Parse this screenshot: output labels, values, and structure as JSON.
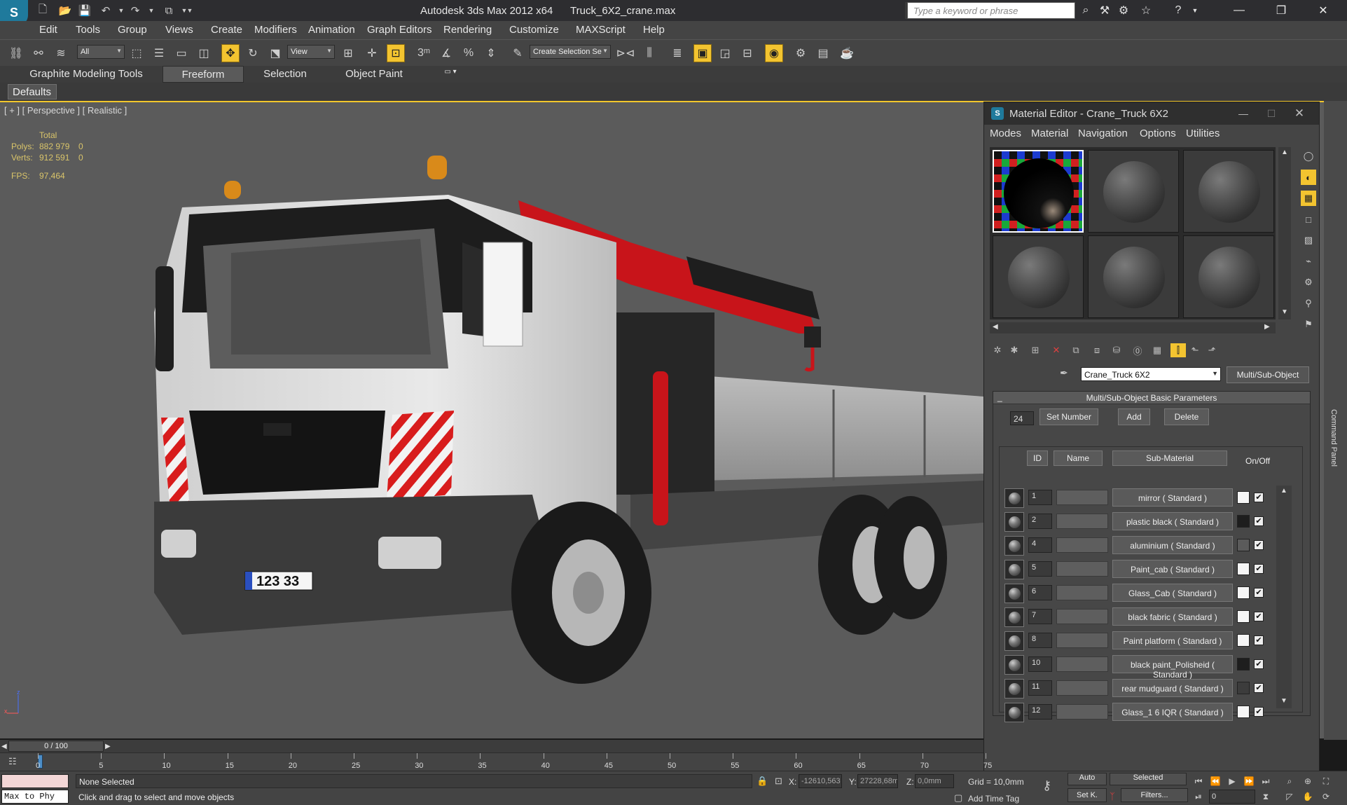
{
  "window": {
    "app_title": "Autodesk 3ds Max  2012 x64",
    "file_name": "Truck_6X2_crane.max",
    "search_placeholder": "Type a keyword or phrase",
    "logo": "3ds-max-logo"
  },
  "menu": [
    "Edit",
    "Tools",
    "Group",
    "Views",
    "Create",
    "Modifiers",
    "Animation",
    "Graph Editors",
    "Rendering",
    "Customize",
    "MAXScript",
    "Help"
  ],
  "toolbar": {
    "selection_filter": "All",
    "ref_coord": "View",
    "named_selection": "Create Selection Se",
    "snap_label": "3"
  },
  "ribbon": {
    "tabs": [
      "Graphite Modeling Tools",
      "Freeform",
      "Selection",
      "Object Paint"
    ],
    "active_tab": "Freeform",
    "sub_button": "Defaults"
  },
  "viewport": {
    "label": "[ + ] [ Perspective ] [ Realistic ]",
    "stats_header": "Total",
    "polys_label": "Polys:",
    "polys_value": "882 979",
    "polys_sel": "0",
    "verts_label": "Verts:",
    "verts_value": "912 591",
    "verts_sel": "0",
    "fps_label": "FPS:",
    "fps_value": "97,464",
    "plate": "123 33"
  },
  "material_editor": {
    "title": "Material Editor - Crane_Truck 6X2",
    "menus": [
      "Modes",
      "Material",
      "Navigation",
      "Options",
      "Utilities"
    ],
    "material_name": "Crane_Truck 6X2",
    "material_type": "Multi/Sub-Object",
    "rollout_title": "Multi/Sub-Object Basic Parameters",
    "rollout_toggle": "_",
    "count": "24",
    "set_number": "Set Number",
    "add": "Add",
    "delete": "Delete",
    "col_id": "ID",
    "col_name": "Name",
    "col_sub": "Sub-Material",
    "col_onoff": "On/Off",
    "rows": [
      {
        "id": "1",
        "sub": "mirror  ( Standard )",
        "swatch": "#f5f5f5",
        "on": "✔"
      },
      {
        "id": "2",
        "sub": "plastic black  ( Standard )",
        "swatch": "#1e1e1e",
        "on": "✔"
      },
      {
        "id": "4",
        "sub": "aluminium  ( Standard )",
        "swatch": "#5b5b5b",
        "on": "✔"
      },
      {
        "id": "5",
        "sub": "Paint_cab  ( Standard )",
        "swatch": "#f5f5f5",
        "on": "✔"
      },
      {
        "id": "6",
        "sub": "Glass_Cab  ( Standard )",
        "swatch": "#f5f5f5",
        "on": "✔"
      },
      {
        "id": "7",
        "sub": "black fabric  ( Standard )",
        "swatch": "#f5f5f5",
        "on": "✔"
      },
      {
        "id": "8",
        "sub": "Paint platform  ( Standard )",
        "swatch": "#f5f5f5",
        "on": "✔"
      },
      {
        "id": "10",
        "sub": "black paint_Polisheid  ( Standard )",
        "swatch": "#1e1e1e",
        "on": "✔"
      },
      {
        "id": "11",
        "sub": "rear mudguard  ( Standard )",
        "swatch": "#3c3c3c",
        "on": "✔"
      },
      {
        "id": "12",
        "sub": "Glass_1 6 IQR  ( Standard )",
        "swatch": "#f5f5f5",
        "on": "✔"
      }
    ]
  },
  "command_panel_label": "Command Panel",
  "timeline": {
    "frame_display": "0 / 100",
    "ticks": [
      "0",
      "5",
      "10",
      "15",
      "20",
      "25",
      "30",
      "35",
      "40",
      "45",
      "50",
      "55",
      "60",
      "65",
      "70",
      "75"
    ]
  },
  "status": {
    "maxscript_label": "Max to Phy",
    "selection": "None Selected",
    "prompt": "Click and drag to select and move objects",
    "x_label": "X:",
    "x_value": "-12610,563",
    "y_label": "Y:",
    "y_value": "27228,68m",
    "z_label": "Z:",
    "z_value": "0,0mm",
    "grid": "Grid = 10,0mm",
    "add_time_tag": "Add Time Tag",
    "auto_key": "Auto",
    "set_key": "Set K.",
    "key_mode": "Selected",
    "filters": "Filters...",
    "frame": "0"
  },
  "colors": {
    "accent": "#f3c430",
    "viewport_bg": "#5b5b5b",
    "crane_red": "#c8141a"
  }
}
